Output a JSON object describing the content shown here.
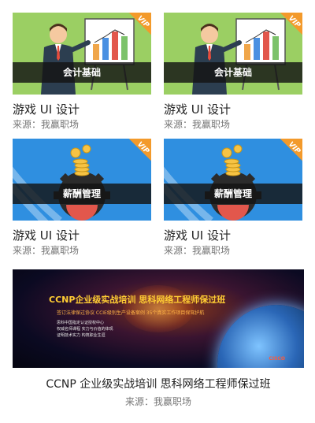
{
  "vip_label": "VIP",
  "colors": {
    "green_thumb": "#9bcf63",
    "blue_thumb": "#2f8fe0",
    "vip_badge": "#f39a2b",
    "banner_bg": "#141414"
  },
  "cards": [
    {
      "banner": "会计基础",
      "title": "游戏 UI 设计",
      "source": "来源：我赢职场",
      "icon": "presenter-with-chart-icon"
    },
    {
      "banner": "会计基础",
      "title": "游戏 UI 设计",
      "source": "来源：我赢职场",
      "icon": "presenter-with-chart-icon"
    },
    {
      "banner": "薪酬管理",
      "title": "游戏 UI 设计",
      "source": "来源：我赢职场",
      "icon": "gear-with-coins-icon"
    },
    {
      "banner": "薪酬管理",
      "title": "游戏 UI 设计",
      "source": "来源：我赢职场",
      "icon": "gear-with-coins-icon"
    }
  ],
  "wide_card": {
    "image_headline": "CCNP企业级实战培训 思科网络工程师保过班",
    "image_sub": "签订法律保过协议  CCIE级别生产设备案例  35个真实工作项目保驾护航",
    "image_lines": [
      "思科中国指定认证授权中心",
      "权威名师课程 实力与价值的体现",
      "证明技术实力 构筑职业生涯"
    ],
    "image_logo": "CISCO",
    "title": "CCNP 企业级实战培训 思科网络工程师保过班",
    "source": "来源：我赢职场"
  }
}
